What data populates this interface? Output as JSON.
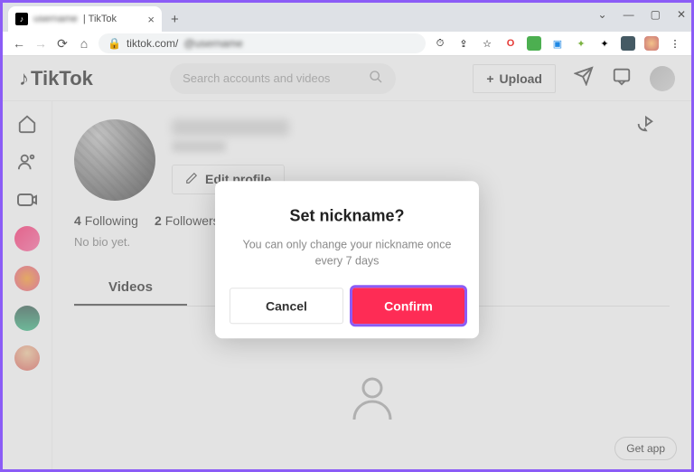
{
  "browser": {
    "tab_title_blur": "username",
    "tab_suffix": " | TikTok",
    "url_host": "tiktok.com/",
    "url_blur": "@username"
  },
  "window_controls": {
    "min": "—",
    "max": "▢",
    "close": "✕",
    "drop": "⌄"
  },
  "header": {
    "logo_text": "TikTok",
    "search_placeholder": "Search accounts and videos",
    "upload_label": "Upload"
  },
  "profile": {
    "edit_label": "Edit profile",
    "following_count": "4",
    "following_label": "Following",
    "followers_count": "2",
    "followers_label": "Followers",
    "bio_text": "No bio yet.",
    "tab_videos": "Videos"
  },
  "modal": {
    "title": "Set nickname?",
    "message": "You can only change your nickname once every 7 days",
    "cancel": "Cancel",
    "confirm": "Confirm"
  },
  "footer": {
    "get_app": "Get app"
  }
}
